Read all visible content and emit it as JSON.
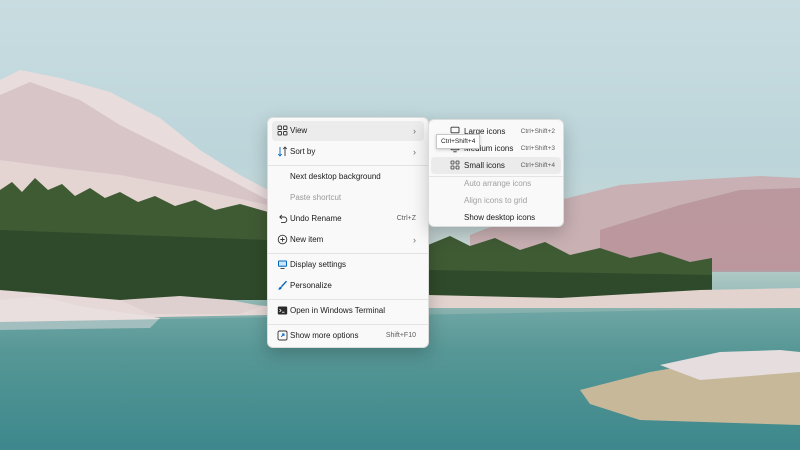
{
  "context_menu": {
    "items": [
      {
        "label": "View",
        "icon": "view-grid-icon",
        "has_submenu": true
      },
      {
        "label": "Sort by",
        "icon": "sort-icon",
        "has_submenu": true
      },
      {
        "label": "Next desktop background",
        "icon": "",
        "has_submenu": false
      },
      {
        "label": "Paste shortcut",
        "icon": "",
        "has_submenu": false,
        "disabled": true
      },
      {
        "label": "Undo Rename",
        "icon": "undo-icon",
        "shortcut": "Ctrl+Z"
      },
      {
        "label": "New item",
        "icon": "add-circle-icon",
        "has_submenu": true
      },
      {
        "label": "Display settings",
        "icon": "display-icon"
      },
      {
        "label": "Personalize",
        "icon": "brush-icon"
      },
      {
        "label": "Open in Windows Terminal",
        "icon": "terminal-icon"
      },
      {
        "label": "Show more options",
        "icon": "more-options-icon",
        "shortcut": "Shift+F10"
      }
    ]
  },
  "view_submenu": {
    "items": [
      {
        "label": "Large icons",
        "icon": "monitor-icon",
        "shortcut": "Ctrl+Shift+2"
      },
      {
        "label": "Medium icons",
        "icon": "monitor-icon",
        "shortcut": "Ctrl+Shift+3"
      },
      {
        "label": "Small icons",
        "icon": "small-grid-icon",
        "shortcut": "Ctrl+Shift+4",
        "selected": true
      },
      {
        "label": "Auto arrange icons",
        "disabled": true
      },
      {
        "label": "Align icons to grid",
        "disabled": true
      },
      {
        "label": "Show desktop icons"
      }
    ]
  },
  "tooltip": {
    "text": "Ctrl+Shift+4"
  },
  "colors": {
    "menu_bg": "#f9f9f9",
    "hover_bg": "#ececec",
    "accent": "#0067c0",
    "disabled_text": "#9a9a9a"
  }
}
